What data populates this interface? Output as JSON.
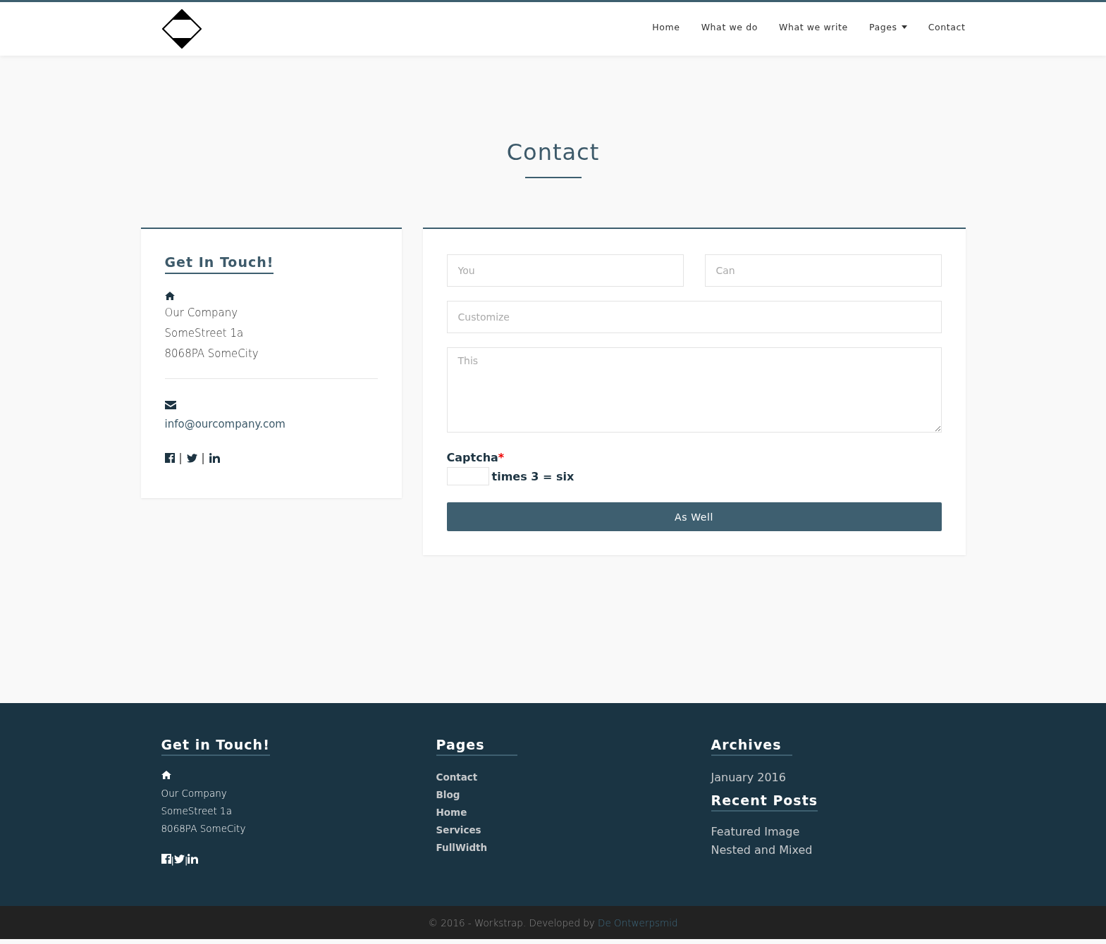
{
  "header": {
    "nav": [
      {
        "label": "Home",
        "kind": "link"
      },
      {
        "label": "What we do",
        "kind": "link"
      },
      {
        "label": "What we write",
        "kind": "link"
      },
      {
        "label": "Pages",
        "kind": "dropdown"
      },
      {
        "label": "Contact",
        "kind": "link"
      }
    ]
  },
  "page_title": "Contact",
  "info_card": {
    "title": "Get In Touch!",
    "address": [
      "Our Company",
      "SomeStreet 1a",
      "8068PA SomeCity"
    ],
    "email": "info@ourcompany.com",
    "social": {
      "icons": [
        {
          "kind": "facebook"
        },
        {
          "kind": "twitter"
        },
        {
          "kind": "linkedin"
        }
      ],
      "separators": [
        "|",
        "|"
      ]
    }
  },
  "form": {
    "fields": [
      {
        "kind": "input",
        "placeholder": "You"
      },
      {
        "kind": "input",
        "placeholder": "Can"
      },
      {
        "kind": "input",
        "placeholder": "Customize"
      },
      {
        "kind": "textarea",
        "placeholder": "This"
      }
    ],
    "captcha": {
      "label": "Captcha",
      "required_mark": "*",
      "question": "times 3 = six"
    },
    "submit": "As Well"
  },
  "footer": {
    "columns": [
      {
        "kind": "contact",
        "title": "Get in Touch!",
        "address": [
          "Our Company",
          "SomeStreet 1a",
          "8068PA SomeCity"
        ],
        "social": {
          "icons": [
            {
              "kind": "facebook"
            },
            {
              "kind": "twitter"
            },
            {
              "kind": "linkedin"
            }
          ],
          "separators": [
            "|",
            "|"
          ]
        }
      },
      {
        "kind": "links",
        "title": "Pages",
        "links": [
          "Contact",
          "Blog",
          "Home",
          "Services",
          "FullWidth"
        ]
      },
      {
        "kind": "archives",
        "title": "Archives",
        "links": [
          "January 2016"
        ],
        "title_2": "Recent Posts",
        "links_2": [
          "Featured Image",
          "Nested and Mixed"
        ]
      }
    ]
  },
  "copyright": {
    "text": "© 2016 - Workstrap. Developed by ",
    "link": "De Ontwerpsmid"
  }
}
